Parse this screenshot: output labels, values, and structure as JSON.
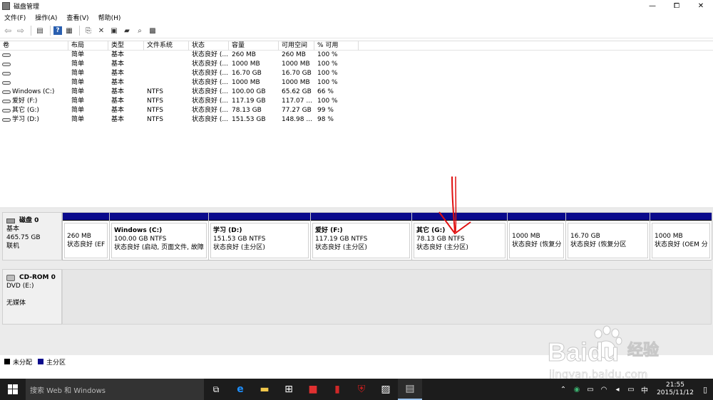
{
  "window": {
    "title": "磁盘管理",
    "controls": {
      "minimize": "—",
      "maximize": "⧠",
      "close": "✕"
    }
  },
  "menu": [
    "文件(F)",
    "操作(A)",
    "查看(V)",
    "帮助(H)"
  ],
  "toolbar": [
    "back-icon",
    "forward-icon",
    "console-icon",
    "help-icon",
    "list-icon",
    "refresh-icon",
    "delete-icon",
    "properties-icon",
    "open-icon",
    "search-icon",
    "settings-icon"
  ],
  "volume_table": {
    "headers": [
      "卷",
      "布局",
      "类型",
      "文件系统",
      "状态",
      "容量",
      "可用空间",
      "% 可用"
    ],
    "rows": [
      [
        "",
        "简单",
        "基本",
        "",
        "状态良好 (...",
        "260 MB",
        "260 MB",
        "100 %"
      ],
      [
        "",
        "简单",
        "基本",
        "",
        "状态良好 (...",
        "1000 MB",
        "1000 MB",
        "100 %"
      ],
      [
        "",
        "简单",
        "基本",
        "",
        "状态良好 (...",
        "16.70 GB",
        "16.70 GB",
        "100 %"
      ],
      [
        "",
        "简单",
        "基本",
        "",
        "状态良好 (...",
        "1000 MB",
        "1000 MB",
        "100 %"
      ],
      [
        "Windows (C:)",
        "简单",
        "基本",
        "NTFS",
        "状态良好 (...",
        "100.00 GB",
        "65.62 GB",
        "66 %"
      ],
      [
        "爱好 (F:)",
        "简单",
        "基本",
        "NTFS",
        "状态良好 (...",
        "117.19 GB",
        "117.07 ...",
        "100 %"
      ],
      [
        "其它 (G:)",
        "简单",
        "基本",
        "NTFS",
        "状态良好 (...",
        "78.13 GB",
        "77.27 GB",
        "99 %"
      ],
      [
        "学习 (D:)",
        "简单",
        "基本",
        "NTFS",
        "状态良好 (...",
        "151.53 GB",
        "148.98 ...",
        "98 %"
      ]
    ]
  },
  "disk0": {
    "name": "磁盘 0",
    "type": "基本",
    "size": "465.75 GB",
    "status": "联机",
    "partitions": [
      {
        "name": "",
        "size": "260 MB",
        "status": "状态良好 (EFI"
      },
      {
        "name": "Windows  (C:)",
        "size": "100.00 GB NTFS",
        "status": "状态良好 (启动, 页面文件, 故障转"
      },
      {
        "name": "学习  (D:)",
        "size": "151.53 GB NTFS",
        "status": "状态良好 (主分区)"
      },
      {
        "name": "爱好  (F:)",
        "size": "117.19 GB NTFS",
        "status": "状态良好 (主分区)"
      },
      {
        "name": "其它  (G:)",
        "size": "78.13 GB NTFS",
        "status": "状态良好 (主分区)"
      },
      {
        "name": "",
        "size": "1000 MB",
        "status": "状态良好 (恢复分"
      },
      {
        "name": "",
        "size": "16.70 GB",
        "status": "状态良好 (恢复分区"
      },
      {
        "name": "",
        "size": "1000 MB",
        "status": "状态良好 (OEM 分"
      }
    ]
  },
  "cdrom0": {
    "name": "CD-ROM 0",
    "drive": "DVD (E:)",
    "media": "无媒体"
  },
  "legend": [
    {
      "label": "未分配",
      "color": "#000000"
    },
    {
      "label": "主分区",
      "color": "#0a0a8c"
    }
  ],
  "taskbar": {
    "search_placeholder": "搜索 Web 和 Windows",
    "apps": [
      "task-view-icon",
      "edge-icon",
      "file-explorer-icon",
      "store-icon",
      "app-red-icon",
      "app-red2-icon",
      "mcafee-icon",
      "photos-icon",
      "disk-mgmt-icon"
    ],
    "time": "21:55",
    "date": "2015/11/12",
    "ime": "中"
  },
  "watermark": {
    "brand": "Baidu",
    "suffix": "经验",
    "url": "jingyan.baidu.com"
  }
}
